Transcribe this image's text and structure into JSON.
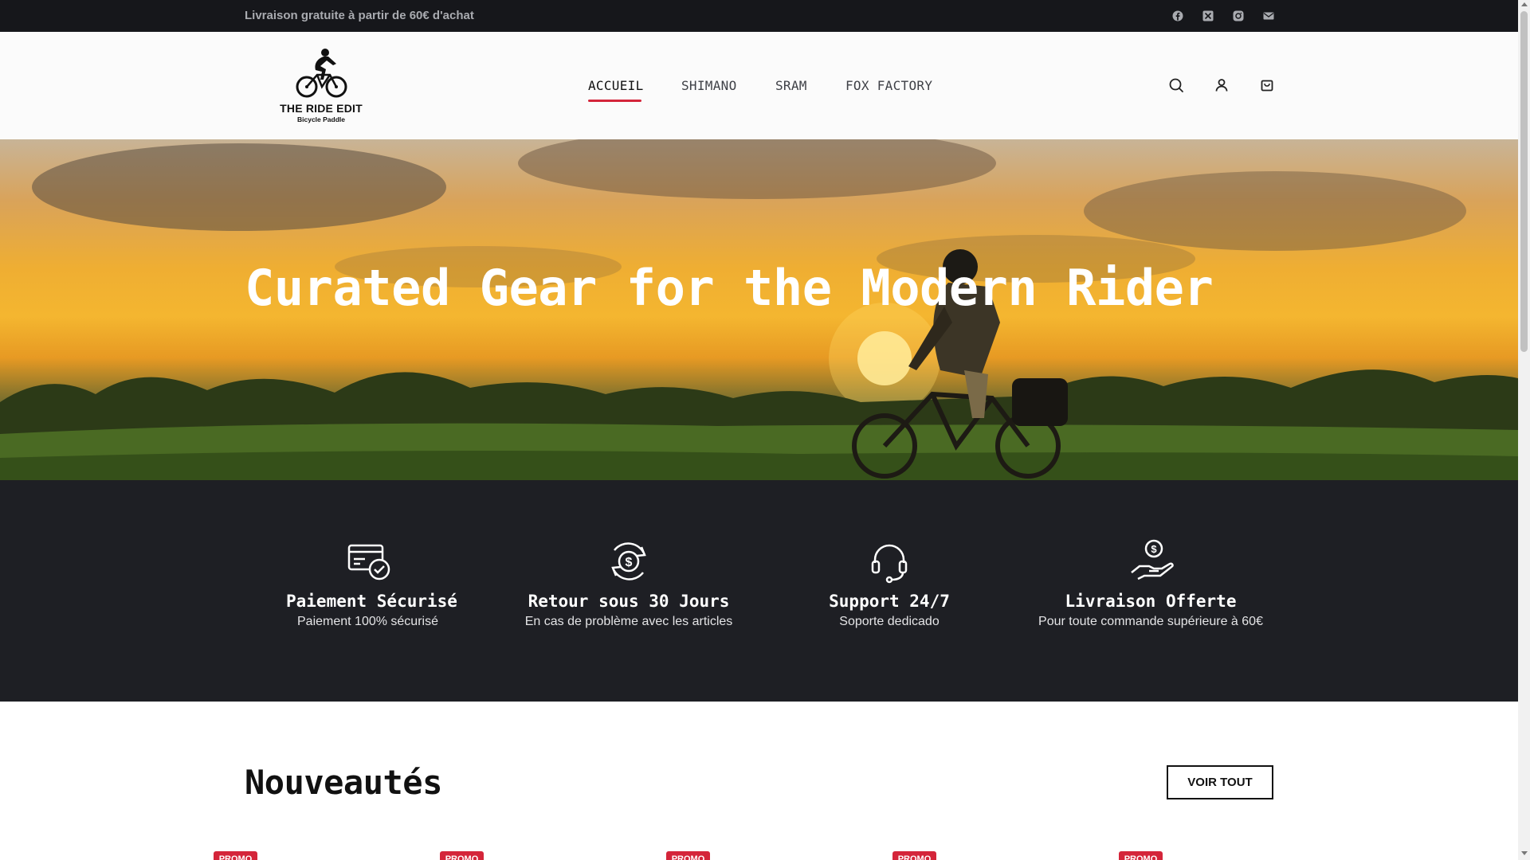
{
  "topbar": {
    "text": "Livraison gratuite à partir de 60€ d'achat",
    "social_icons": [
      "facebook-icon",
      "x-icon",
      "instagram-icon",
      "mail-icon"
    ]
  },
  "header": {
    "logo": {
      "title": "THE RIDE EDIT",
      "subtitle": "Bicycle Paddle"
    },
    "nav": [
      {
        "label": "ACCUEIL",
        "active": true
      },
      {
        "label": "SHIMANO",
        "active": false
      },
      {
        "label": "SRAM",
        "active": false
      },
      {
        "label": "FOX FACTORY",
        "active": false
      }
    ],
    "icons": [
      "search-icon",
      "user-icon",
      "cart-icon"
    ]
  },
  "hero": {
    "title": "Curated Gear for the Modern Rider"
  },
  "features": [
    {
      "icon": "credit-card-check-icon",
      "title": "Paiement Sécurisé",
      "description": "Paiement 100% sécurisé"
    },
    {
      "icon": "refund-dollar-icon",
      "title": "Retour sous 30 Jours",
      "description": "En cas de problème avec les articles"
    },
    {
      "icon": "headset-icon",
      "title": "Support 24/7",
      "description": "Soporte dedicado"
    },
    {
      "icon": "hand-dollar-icon",
      "title": "Livraison Offerte",
      "description": "Pour toute commande supérieure à 60€"
    }
  ],
  "new_arrivals": {
    "title": "Nouveautés",
    "button_label": "VOIR TOUT",
    "badges": [
      "PROMO",
      "PROMO",
      "PROMO",
      "PROMO",
      "PROMO"
    ]
  },
  "colors": {
    "accent": "#d4253a",
    "topbar_bg": "#16171b",
    "features_bg": "#1e1f24"
  }
}
